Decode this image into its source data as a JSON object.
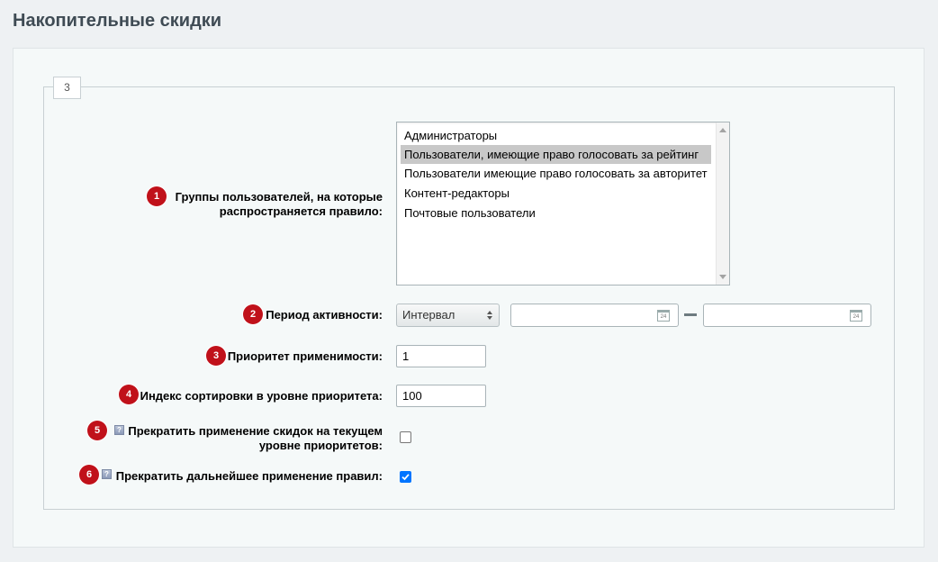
{
  "page": {
    "title": "Накопительные скидки"
  },
  "tab": {
    "label": "3"
  },
  "fields": {
    "groups": {
      "badge": "1",
      "label": "Группы пользователей, на которые распространяется правило:",
      "options": [
        "Администраторы",
        "Пользователи, имеющие право голосовать за рейтинг",
        "Пользователи имеющие право голосовать за авторитет",
        "Контент-редакторы",
        "Почтовые пользователи"
      ],
      "selected": "Пользователи, имеющие право голосовать за рейтинг"
    },
    "period": {
      "badge": "2",
      "label": "Период активности:",
      "select_value": "Интервал",
      "date_from": "",
      "date_to": "",
      "calendar_icon_text": "24"
    },
    "priority": {
      "badge": "3",
      "label": "Приоритет применимости:",
      "value": "1"
    },
    "sort": {
      "badge": "4",
      "label": "Индекс сортировки в уровне приоритета:",
      "value": "100"
    },
    "stop_discounts": {
      "badge": "5",
      "label": "Прекратить применение скидок на текущем уровне приоритетов:",
      "help_icon": "question-icon",
      "checked": false
    },
    "stop_rules": {
      "badge": "6",
      "label": "Прекратить дальнейшее применение правил:",
      "help_icon": "question-icon",
      "checked": true
    }
  },
  "colors": {
    "badge": "#c0111a",
    "checkbox_checked": "#0075ff",
    "list_selected": "#c8c8c8"
  }
}
